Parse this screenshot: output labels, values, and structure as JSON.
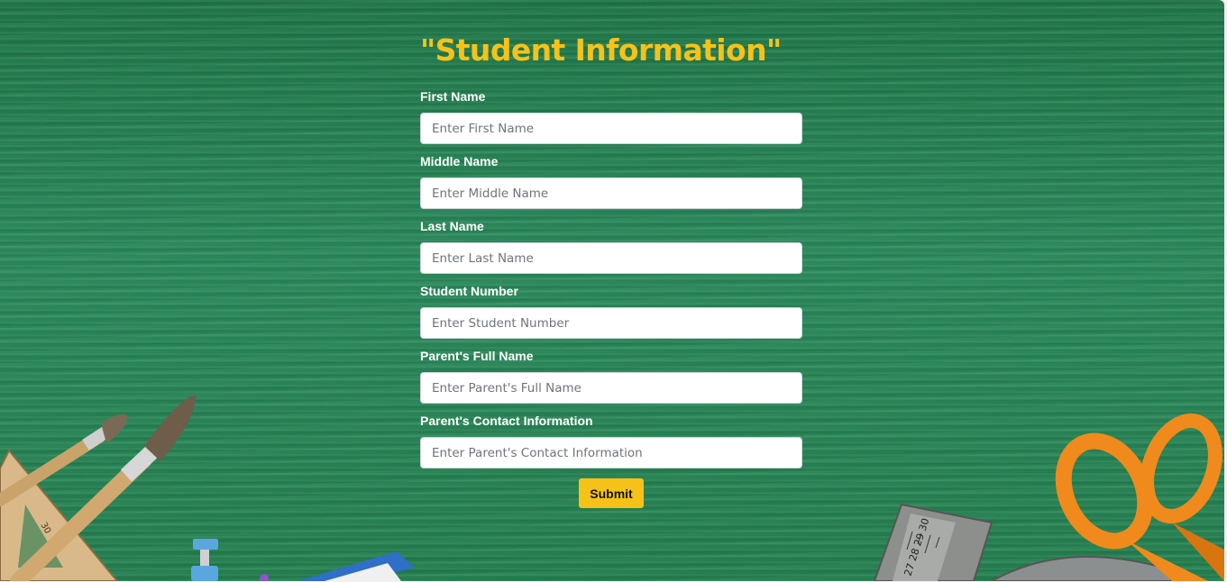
{
  "form": {
    "title": "\"Student Information\"",
    "fields": [
      {
        "label": "First Name",
        "placeholder": "Enter First Name"
      },
      {
        "label": "Middle Name",
        "placeholder": "Enter Middle Name"
      },
      {
        "label": "Last Name",
        "placeholder": "Enter Last Name"
      },
      {
        "label": "Student Number",
        "placeholder": "Enter Student Number"
      },
      {
        "label": "Parent's Full Name",
        "placeholder": "Enter Parent's Full Name"
      },
      {
        "label": "Parent's Contact Information",
        "placeholder": "Enter Parent's Contact Information"
      }
    ],
    "submit_label": "Submit"
  },
  "colors": {
    "background": "#1f7a4d",
    "title": "#f6c218",
    "submit": "#f6c218",
    "label": "#ffffff"
  },
  "decorations": [
    "paintbrush-icon",
    "set-square-icon",
    "ruler-icon",
    "scissors-icon",
    "pushpin-icon",
    "pencil-case-icon"
  ]
}
